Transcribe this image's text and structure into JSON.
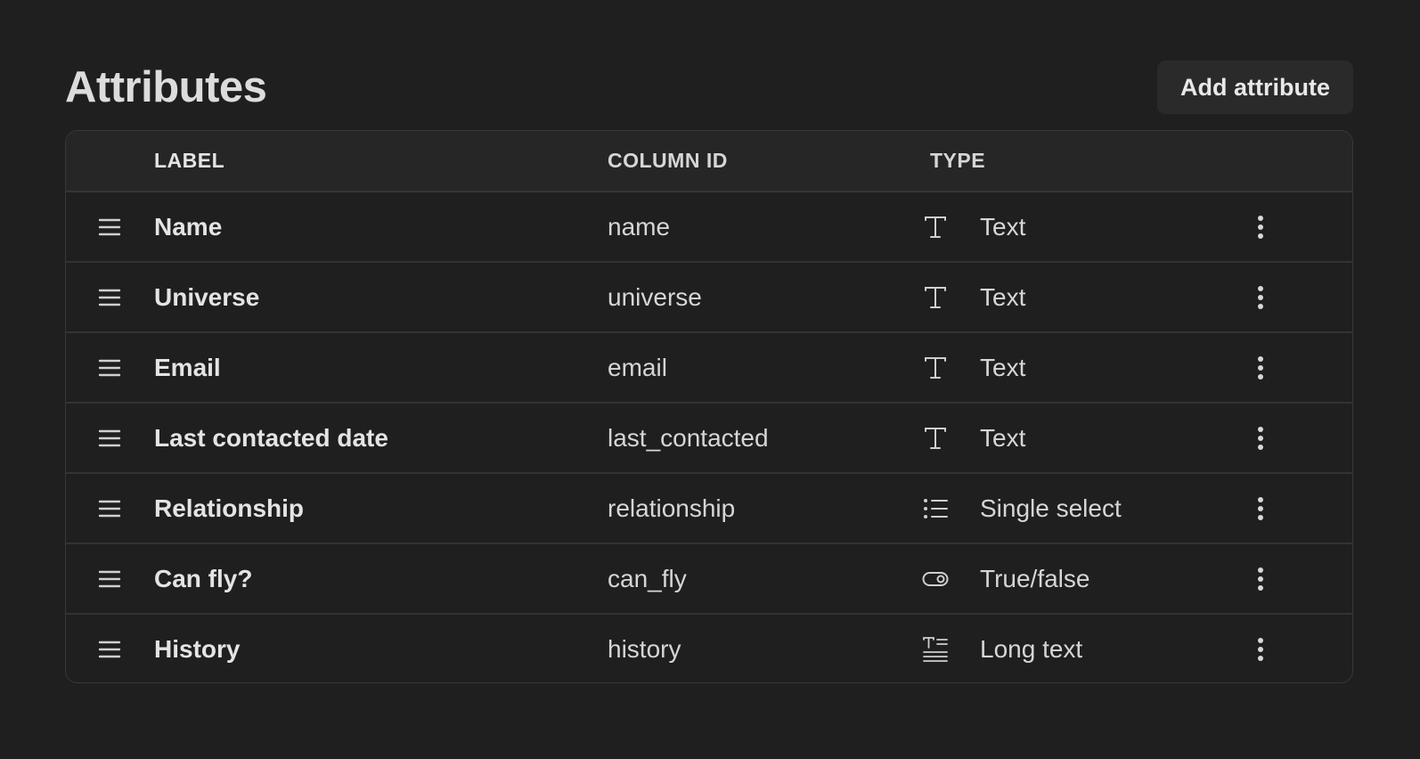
{
  "page": {
    "title": "Attributes",
    "add_button_label": "Add attribute"
  },
  "table": {
    "headers": {
      "label": "LABEL",
      "column_id": "COLUMN ID",
      "type": "TYPE"
    },
    "rows": [
      {
        "label": "Name",
        "column_id": "name",
        "type": "Text",
        "type_icon": "text-type-icon"
      },
      {
        "label": "Universe",
        "column_id": "universe",
        "type": "Text",
        "type_icon": "text-type-icon"
      },
      {
        "label": "Email",
        "column_id": "email",
        "type": "Text",
        "type_icon": "text-type-icon"
      },
      {
        "label": "Last contacted date",
        "column_id": "last_contacted",
        "type": "Text",
        "type_icon": "text-type-icon"
      },
      {
        "label": "Relationship",
        "column_id": "relationship",
        "type": "Single select",
        "type_icon": "list-type-icon"
      },
      {
        "label": "Can fly?",
        "column_id": "can_fly",
        "type": "True/false",
        "type_icon": "toggle-type-icon"
      },
      {
        "label": "History",
        "column_id": "history",
        "type": "Long text",
        "type_icon": "long-text-type-icon"
      }
    ]
  },
  "icons": {
    "row_handle": "drag-handle-icon",
    "row_menu": "more-vertical-icon"
  },
  "colors": {
    "background": "#1f1f1f",
    "header_background": "#262626",
    "button_background": "#2a2a2a",
    "border": "#383838"
  }
}
